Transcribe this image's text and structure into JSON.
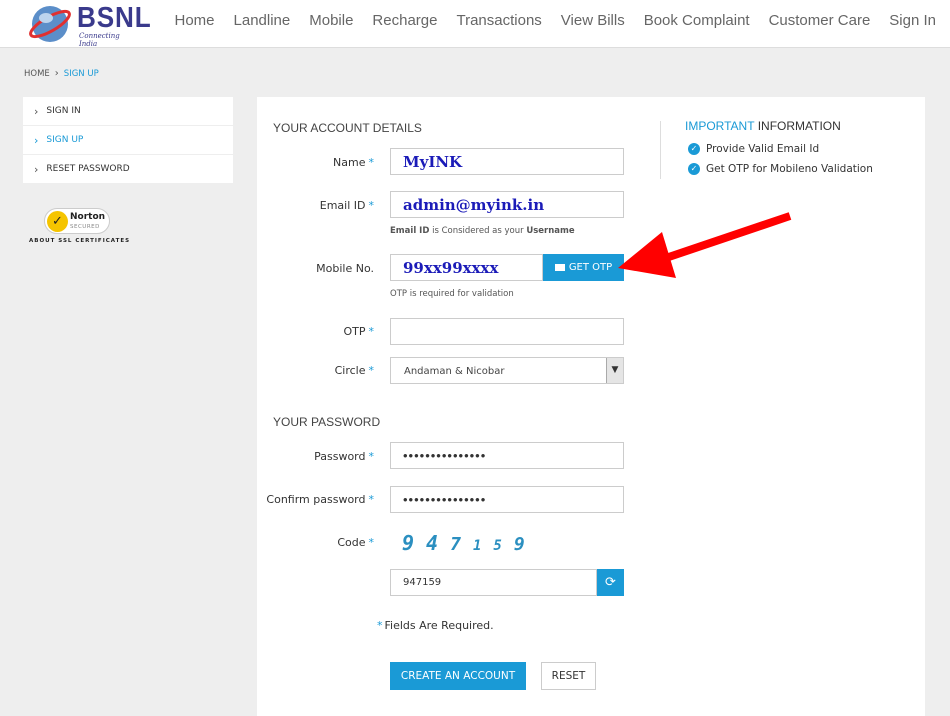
{
  "brand": {
    "name": "BSNL",
    "tagline": "Connecting India"
  },
  "nav": [
    "Home",
    "Landline",
    "Mobile",
    "Recharge",
    "Transactions",
    "View Bills",
    "Book Complaint",
    "Customer Care",
    "Sign In"
  ],
  "breadcrumb": {
    "home": "HOME",
    "current": "SIGN UP"
  },
  "sidebar": {
    "items": [
      {
        "label": "SIGN IN"
      },
      {
        "label": "SIGN UP"
      },
      {
        "label": "RESET PASSWORD"
      }
    ]
  },
  "norton": {
    "title": "Norton",
    "sub": "SECURED",
    "link": "ABOUT SSL CERTIFICATES"
  },
  "account": {
    "section": "YOUR ACCOUNT DETAILS",
    "name_label": "Name",
    "name_value": "MyINK",
    "email_label": "Email ID",
    "email_value": "admin@myink.in",
    "email_hint_bold1": "Email ID",
    "email_hint_mid": " is Considered as your ",
    "email_hint_bold2": "Username",
    "mobile_label": "Mobile No.",
    "mobile_value": "99xx99xxxx",
    "otp_button": "GET OTP",
    "mobile_hint": "OTP is required for validation",
    "otp_label": "OTP",
    "otp_value": "",
    "circle_label": "Circle",
    "circle_value": "Andaman & Nicobar"
  },
  "password": {
    "section": "YOUR PASSWORD",
    "password_label": "Password",
    "password_value": "•••••••••••••••",
    "confirm_label": "Confirm password",
    "confirm_value": "•••••••••••••••",
    "code_label": "Code",
    "captcha": [
      "9",
      "4",
      "7",
      "1",
      "5",
      "9"
    ],
    "code_value": "947159"
  },
  "required_asterisk": "*",
  "required_note": "Fields Are Required.",
  "buttons": {
    "create": "CREATE AN ACCOUNT",
    "reset": "RESET"
  },
  "info": {
    "title_highlight": "IMPORTANT",
    "title_rest": "INFORMATION",
    "items": [
      "Provide Valid Email Id",
      "Get OTP for Mobileno Validation"
    ]
  },
  "colors": {
    "accent": "#1a9ad6",
    "arrow": "#ff0000",
    "brand": "#3a3a8c"
  },
  "icons": {
    "otp": "envelope-icon",
    "refresh": "refresh-icon",
    "check": "check-circle-icon",
    "chevron": "chevron-right-icon"
  }
}
